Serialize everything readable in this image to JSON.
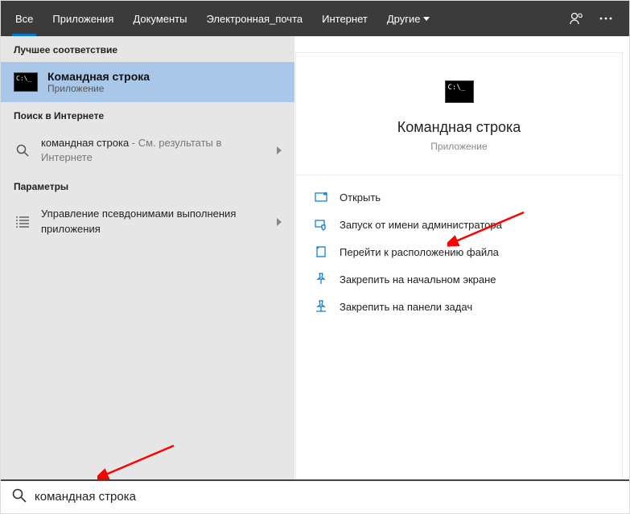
{
  "topbar": {
    "tabs": [
      "Все",
      "Приложения",
      "Документы",
      "Электронная_почта",
      "Интернет",
      "Другие"
    ]
  },
  "left": {
    "best_match_label": "Лучшее соответствие",
    "best_match": {
      "title": "Командная строка",
      "subtitle": "Приложение"
    },
    "web_label": "Поиск в Интернете",
    "web_item": {
      "term": "командная строка",
      "suffix": " - См. результаты в Интернете"
    },
    "params_label": "Параметры",
    "params_item": "Управление псевдонимами выполнения приложения"
  },
  "right": {
    "title": "Командная строка",
    "subtitle": "Приложение",
    "actions": [
      "Открыть",
      "Запуск от имени администратора",
      "Перейти к расположению файла",
      "Закрепить на начальном экране",
      "Закрепить на панели задач"
    ]
  },
  "search": {
    "value": "командная строка"
  }
}
